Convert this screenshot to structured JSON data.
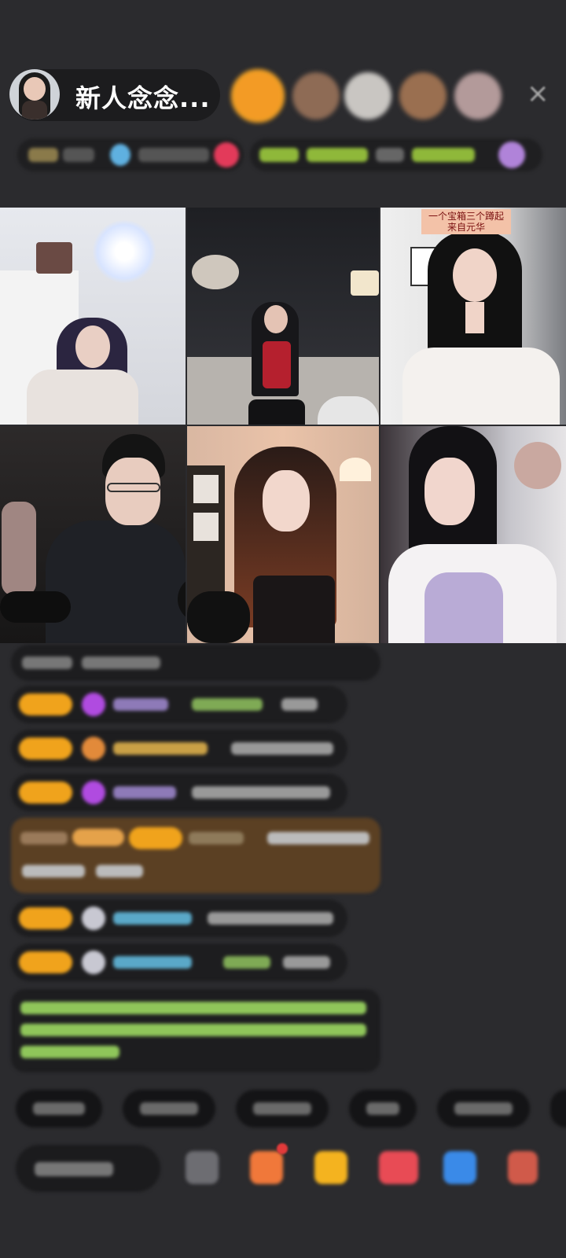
{
  "header": {
    "host_name": "新人念念...",
    "close_label": "×"
  },
  "overlay_caption": "一个宝箱三个蹲起 来自元华",
  "icons": {
    "close": "close-icon",
    "gift": "gift-icon",
    "more": "more-icon"
  },
  "colors": {
    "background": "#2b2b2e",
    "level_badge": "#f0a31c",
    "chat_green": "#8fc65a",
    "gift_banner": "#5b4023"
  }
}
